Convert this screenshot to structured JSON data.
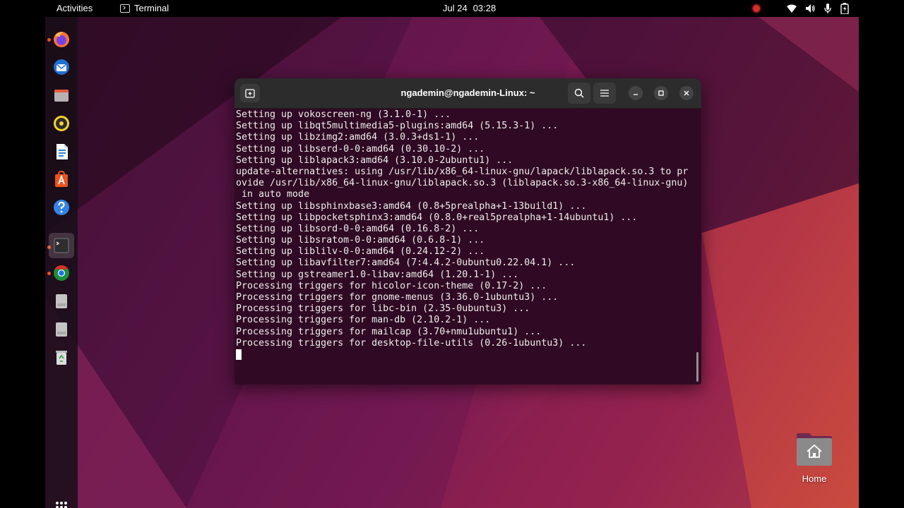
{
  "topbar": {
    "activities": "Activities",
    "app_name": "Terminal",
    "date": "Jul 24",
    "time": "03:28",
    "tray_icons": [
      "record-indicator-icon",
      "wifi-icon",
      "volume-icon",
      "microphone-icon",
      "battery-icon"
    ]
  },
  "dock": {
    "items": [
      {
        "name": "firefox",
        "running": true
      },
      {
        "name": "thunderbird",
        "running": false
      },
      {
        "name": "files",
        "running": false
      },
      {
        "name": "rhythmbox",
        "running": false
      },
      {
        "name": "libreoffice-writer",
        "running": false
      },
      {
        "name": "ubuntu-software",
        "running": false
      },
      {
        "name": "help",
        "running": false
      },
      {
        "name": "terminal",
        "running": true,
        "active": true
      },
      {
        "name": "chrome",
        "running": true
      },
      {
        "name": "disk-1",
        "running": false
      },
      {
        "name": "disk-2",
        "running": false
      },
      {
        "name": "trash",
        "running": false
      }
    ],
    "show_apps_icon": "apps-grid-icon"
  },
  "terminal": {
    "title": "ngademin@ngademin-Linux: ~",
    "background": "#300a24",
    "lines": [
      "Setting up vokoscreen-ng (3.1.0-1) ...",
      "Setting up libqt5multimedia5-plugins:amd64 (5.15.3-1) ...",
      "Setting up libzimg2:amd64 (3.0.3+ds1-1) ...",
      "Setting up libserd-0-0:amd64 (0.30.10-2) ...",
      "Setting up liblapack3:amd64 (3.10.0-2ubuntu1) ...",
      "update-alternatives: using /usr/lib/x86_64-linux-gnu/lapack/liblapack.so.3 to pr",
      "ovide /usr/lib/x86_64-linux-gnu/liblapack.so.3 (liblapack.so.3-x86_64-linux-gnu)",
      " in auto mode",
      "Setting up libsphinxbase3:amd64 (0.8+5prealpha+1-13build1) ...",
      "Setting up libpocketsphinx3:amd64 (0.8.0+real5prealpha+1-14ubuntu1) ...",
      "Setting up libsord-0-0:amd64 (0.16.8-2) ...",
      "Setting up libsratom-0-0:amd64 (0.6.8-1) ...",
      "Setting up liblilv-0-0:amd64 (0.24.12-2) ...",
      "Setting up libavfilter7:amd64 (7:4.4.2-0ubuntu0.22.04.1) ...",
      "Setting up gstreamer1.0-libav:amd64 (1.20.1-1) ...",
      "Processing triggers for hicolor-icon-theme (0.17-2) ...",
      "Processing triggers for gnome-menus (3.36.0-1ubuntu3) ...",
      "Processing triggers for libc-bin (2.35-0ubuntu3) ...",
      "Processing triggers for man-db (2.10.2-1) ...",
      "Processing triggers for mailcap (3.70+nmu1ubuntu1) ...",
      "Processing triggers for desktop-file-utils (0.26-1ubuntu3) ..."
    ]
  },
  "desktop": {
    "home_label": "Home"
  }
}
